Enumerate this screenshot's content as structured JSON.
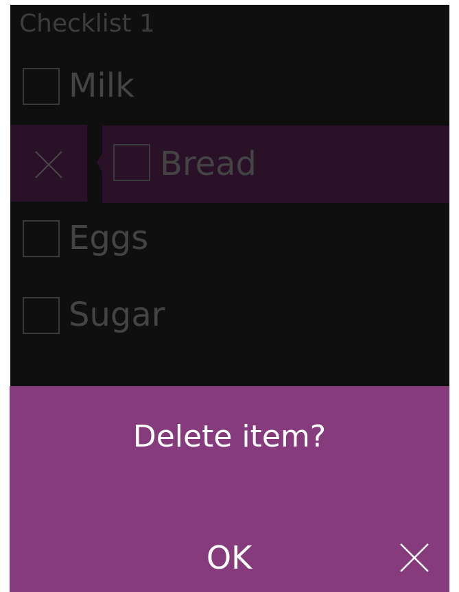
{
  "checklist": {
    "title": "Checklist 1",
    "items": [
      {
        "label": "Milk",
        "checked": false
      },
      {
        "label": "Bread",
        "checked": false,
        "swiped": true
      },
      {
        "label": "Eggs",
        "checked": false
      },
      {
        "label": "Sugar",
        "checked": false
      }
    ]
  },
  "swipe_action": {
    "icon": "close-icon"
  },
  "dialog": {
    "title": "Delete item?",
    "ok_label": "OK",
    "cancel_icon": "close-icon"
  },
  "colors": {
    "background": "#0f0f0f",
    "dim_text": "#444444",
    "accent": "#853b7c",
    "swipe_highlight": "#2a1128",
    "dialog_text": "#ffffff"
  }
}
